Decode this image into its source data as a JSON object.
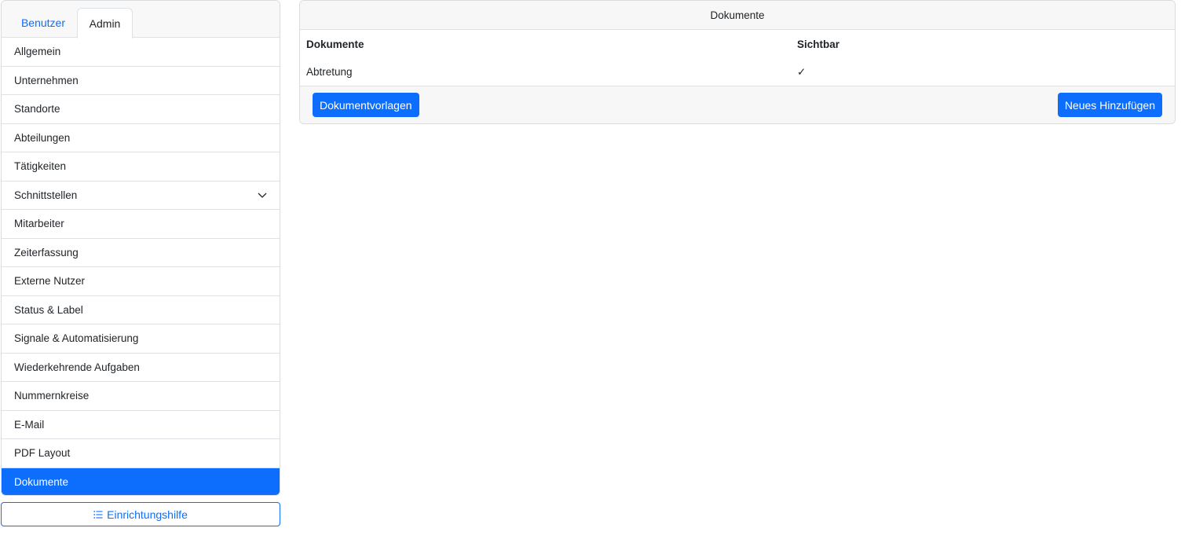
{
  "sidebar": {
    "tabs": [
      {
        "label": "Benutzer",
        "active": false
      },
      {
        "label": "Admin",
        "active": true
      }
    ],
    "items": [
      {
        "label": "Allgemein"
      },
      {
        "label": "Unternehmen"
      },
      {
        "label": "Standorte"
      },
      {
        "label": "Abteilungen"
      },
      {
        "label": "Tätigkeiten"
      },
      {
        "label": "Schnittstellen",
        "icon": "chevron-down-icon"
      },
      {
        "label": "Mitarbeiter"
      },
      {
        "label": "Zeiterfassung"
      },
      {
        "label": "Externe Nutzer"
      },
      {
        "label": "Status & Label"
      },
      {
        "label": "Signale & Automatisierung"
      },
      {
        "label": "Wiederkehrende Aufgaben"
      },
      {
        "label": "Nummernkreise"
      },
      {
        "label": "E-Mail"
      },
      {
        "label": "PDF Layout"
      },
      {
        "label": "Dokumente",
        "active": true
      }
    ],
    "setup_button": {
      "label": "Einrichtungshilfe",
      "icon": "list-icon"
    }
  },
  "main": {
    "title": "Dokumente",
    "table": {
      "columns": [
        "Dokumente",
        "Sichtbar"
      ],
      "rows": [
        {
          "name": "Abtretung",
          "visible": "✓"
        }
      ]
    },
    "footer": {
      "templates_label": "Dokumentvorlagen",
      "add_label": "Neues Hinzufügen"
    }
  },
  "colors": {
    "accent": "#0d6efd",
    "border": "#dee2e6",
    "header_bg": "#f7f7f7"
  }
}
